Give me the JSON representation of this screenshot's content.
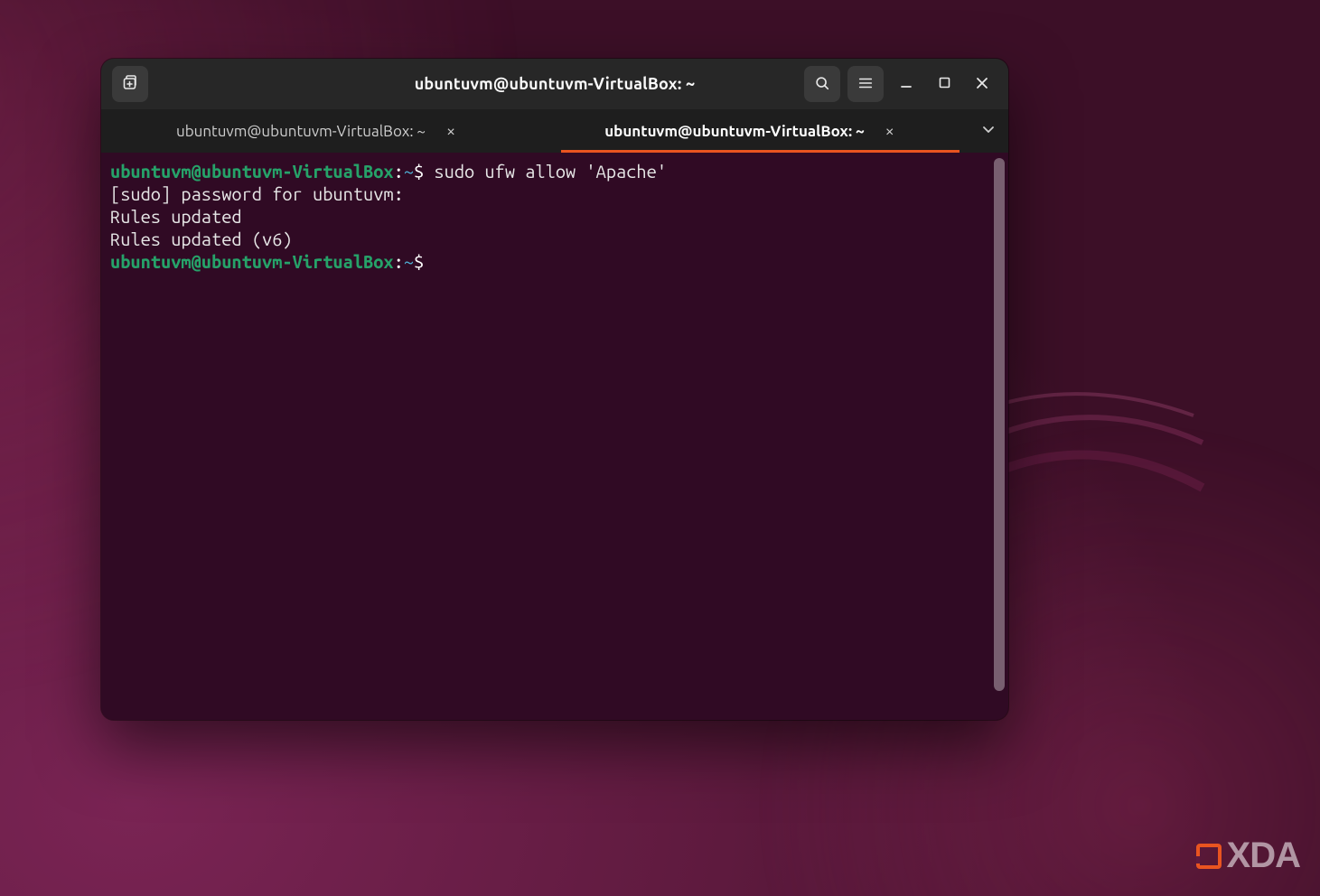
{
  "window": {
    "title": "ubuntuvm@ubuntuvm-VirtualBox: ~"
  },
  "tabs": [
    {
      "label": "ubuntuvm@ubuntuvm-VirtualBox: ~",
      "active": false
    },
    {
      "label": "ubuntuvm@ubuntuvm-VirtualBox: ~",
      "active": true
    }
  ],
  "prompt": {
    "user_host": "ubuntuvm@ubuntuvm-VirtualBox",
    "separator": ":",
    "path": "~",
    "symbol": "$"
  },
  "terminal": {
    "lines": [
      {
        "type": "cmd",
        "command": "sudo ufw allow 'Apache'"
      },
      {
        "type": "output",
        "text": "[sudo] password for ubuntuvm:"
      },
      {
        "type": "output",
        "text": "Rules updated"
      },
      {
        "type": "output",
        "text": "Rules updated (v6)"
      },
      {
        "type": "prompt"
      }
    ]
  },
  "icons": {
    "new_tab": "new-tab-icon",
    "search": "search-icon",
    "menu": "hamburger-icon",
    "minimize": "minimize-icon",
    "maximize": "maximize-icon",
    "close": "close-icon",
    "tab_close": "close-icon",
    "tab_dropdown": "chevron-down-icon"
  },
  "colors": {
    "accent_orange": "#e95420",
    "prompt_green": "#26a269",
    "prompt_blue": "#4fb4d8",
    "terminal_bg": "#300a24",
    "chrome_bg": "#272727"
  },
  "watermark": {
    "text": "XDA"
  }
}
